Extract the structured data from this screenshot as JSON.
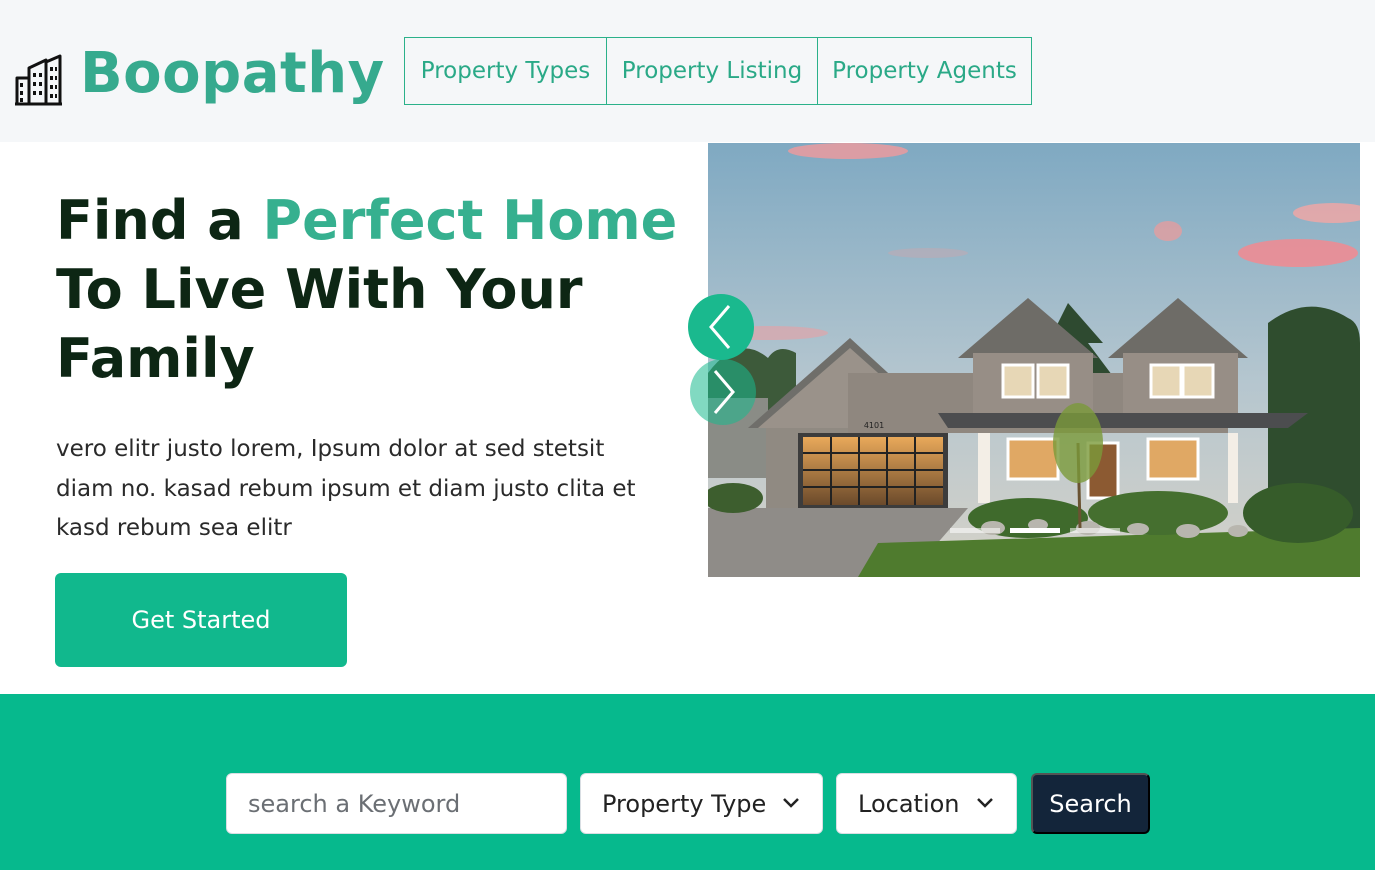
{
  "brand": {
    "name": "Boopathy",
    "icon": "building-icon"
  },
  "nav": {
    "items": [
      {
        "label": "Property Types"
      },
      {
        "label": "Property Listing"
      },
      {
        "label": "Property Agents"
      }
    ]
  },
  "hero": {
    "title_part1": "Find a ",
    "title_accent": "Perfect Home",
    "title_part2": "To Live With Your Family",
    "description": "vero elitr justo lorem, Ipsum dolor at sed stetsit diam no. kasad rebum ipsum et diam justo clita et kasd rebum sea elitr",
    "cta_label": "Get Started"
  },
  "carousel": {
    "prev_icon": "chevron-left-icon",
    "next_icon": "chevron-right-icon",
    "house_number": "4101",
    "slides_count": 3,
    "active_slide": 2
  },
  "search": {
    "keyword_placeholder": "search a Keyword",
    "property_type_value": "Property Type",
    "location_value": "Location",
    "search_label": "Search"
  },
  "colors": {
    "accent": "#36aa8e",
    "primary_button": "#11b88d",
    "search_band": "#06b98d",
    "search_button": "#13253a"
  }
}
